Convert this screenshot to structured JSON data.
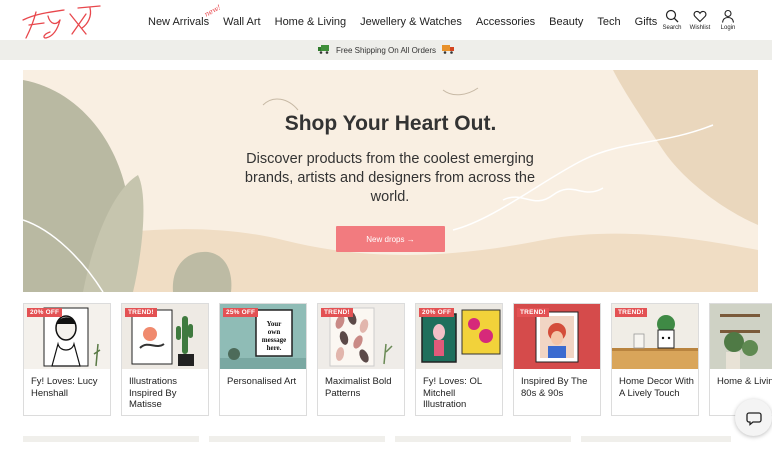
{
  "header": {
    "nav": [
      {
        "label": "New Arrivals",
        "badge": "new!"
      },
      {
        "label": "Wall Art"
      },
      {
        "label": "Home & Living"
      },
      {
        "label": "Jewellery & Watches"
      },
      {
        "label": "Accessories"
      },
      {
        "label": "Beauty"
      },
      {
        "label": "Tech"
      },
      {
        "label": "Gifts"
      }
    ],
    "icons": {
      "search": "Search",
      "wishlist": "Wishlist",
      "login": "Login"
    }
  },
  "shipping": {
    "text": "Free Shipping On All Orders"
  },
  "hero": {
    "title": "Shop Your Heart Out.",
    "subtitle": "Discover products from the coolest emerging brands, artists and designers from across the world.",
    "button": "New drops →"
  },
  "cards": [
    {
      "badge": "20% OFF",
      "label": "Fy! Loves: Lucy Henshall"
    },
    {
      "badge": "TREND!",
      "label": "Illustrations Inspired By Matisse"
    },
    {
      "badge": "25% OFF",
      "label": "Personalised Art"
    },
    {
      "badge": "TREND!",
      "label": "Maximalist Bold Patterns"
    },
    {
      "badge": "20% OFF",
      "label": "Fy! Loves: OL Mitchell Illustration"
    },
    {
      "badge": "TREND!",
      "label": "Inspired By The 80s & 90s"
    },
    {
      "badge": "TREND!",
      "label": "Home Decor With A Lively Touch"
    },
    {
      "badge": "",
      "label": "Home & Living"
    }
  ],
  "poster_text": "Your own message here.",
  "colors": {
    "brand_red": "#e8474c",
    "button": "#f27b7f",
    "hero_bg": "#f9efe2",
    "ship_bar": "#eeeeea"
  }
}
